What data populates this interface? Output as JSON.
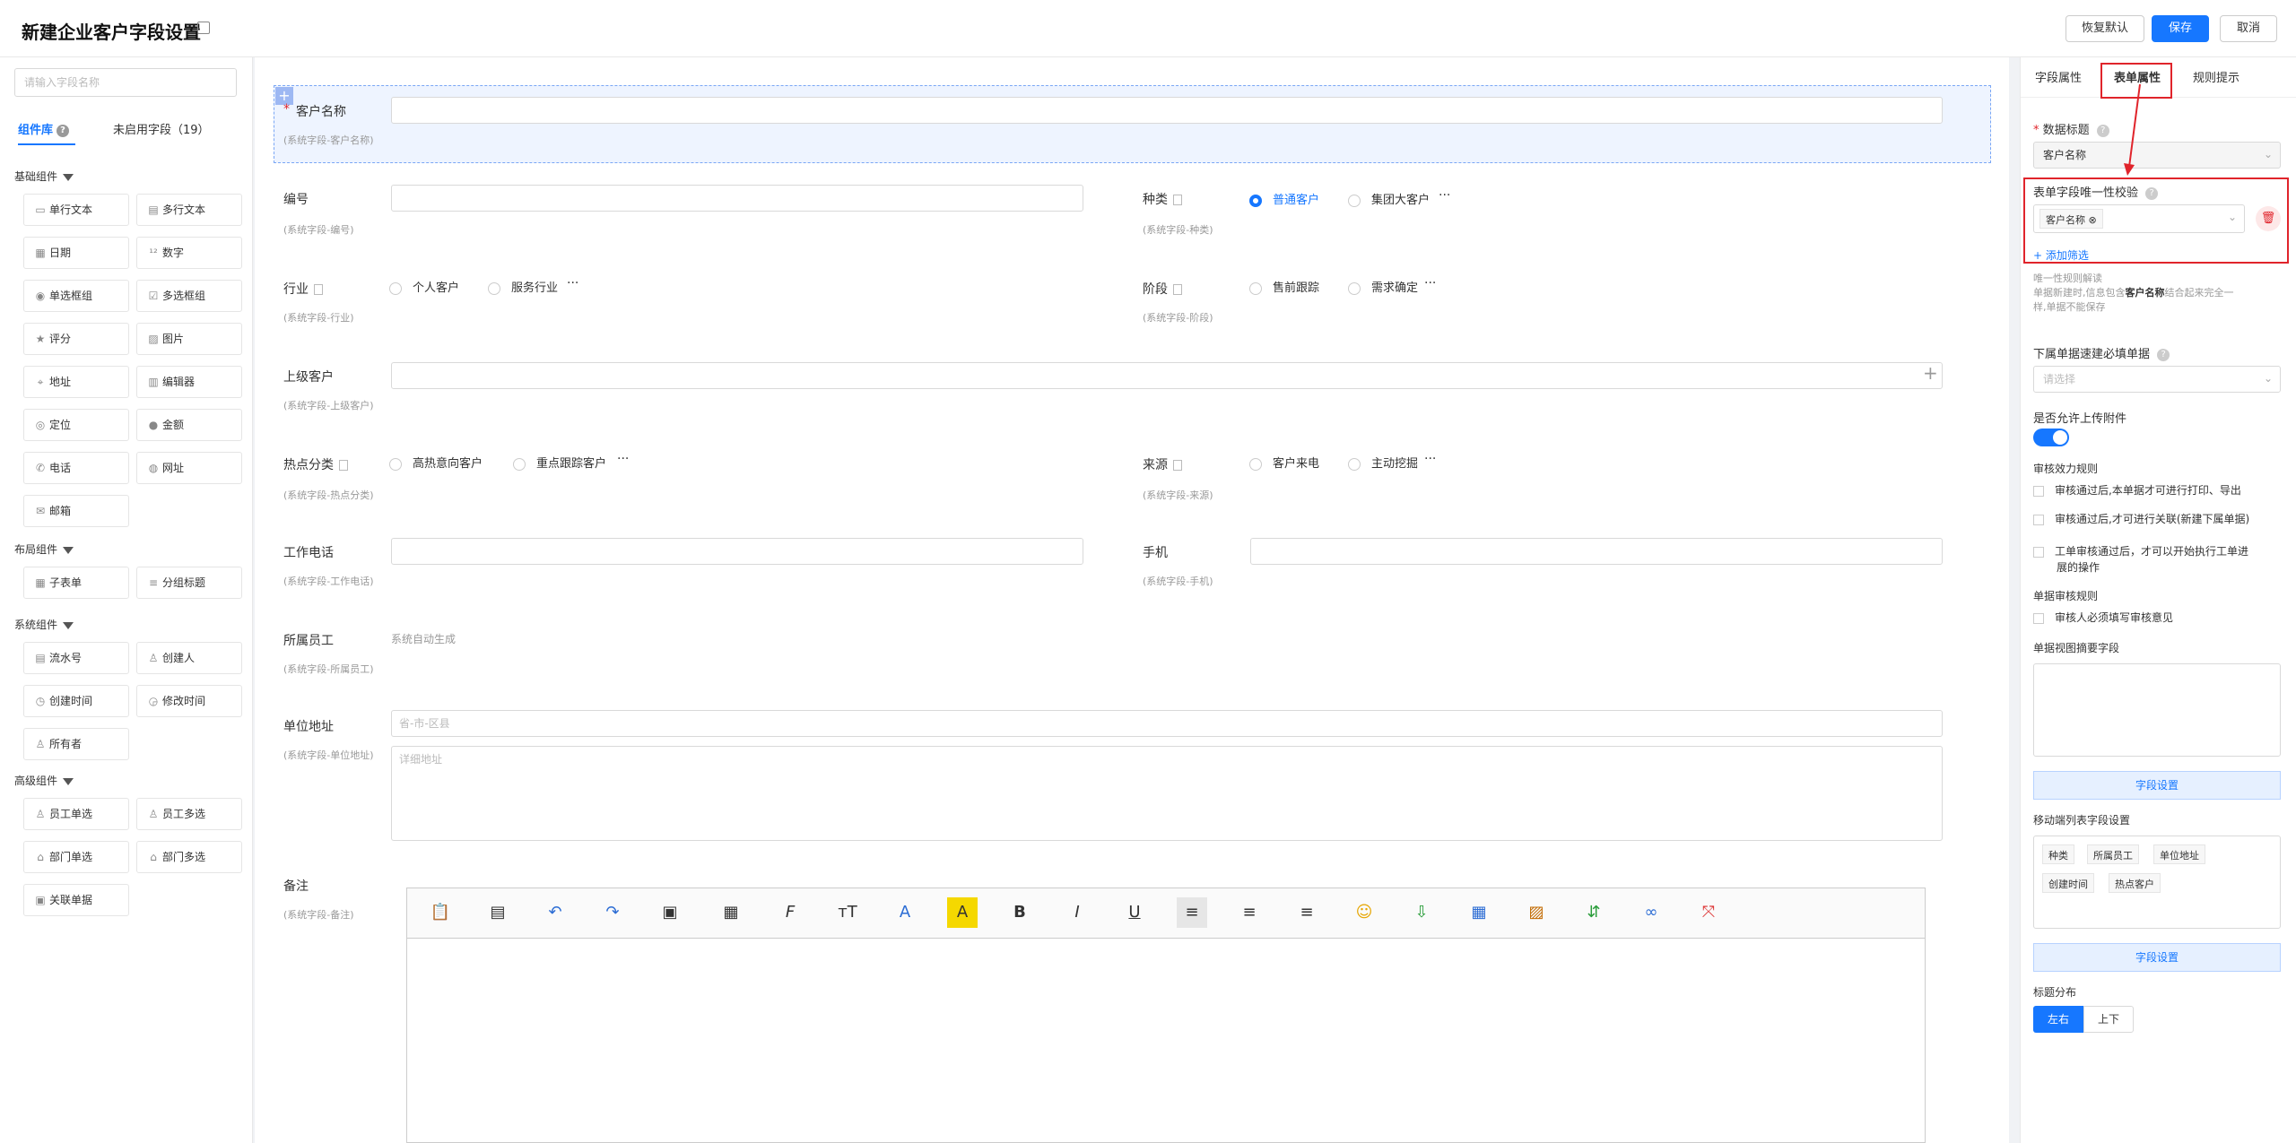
{
  "header": {
    "title": "新建企业客户字段设置",
    "restore": "恢复默认",
    "save": "保存",
    "cancel": "取消"
  },
  "left": {
    "search_placeholder": "请输入字段名称",
    "tab_library": "组件库",
    "tab_unused": "未启用字段（19）",
    "sections": [
      {
        "title": "基础组件",
        "items": [
          {
            "label": "单行文本",
            "icon": "▭"
          },
          {
            "label": "多行文本",
            "icon": "▤"
          },
          {
            "label": "日期",
            "icon": "▦"
          },
          {
            "label": "数字",
            "icon": "¹²"
          },
          {
            "label": "单选框组",
            "icon": "◉"
          },
          {
            "label": "多选框组",
            "icon": "☑"
          },
          {
            "label": "评分",
            "icon": "★"
          },
          {
            "label": "图片",
            "icon": "▨"
          },
          {
            "label": "地址",
            "icon": "⌖"
          },
          {
            "label": "编辑器",
            "icon": "▥"
          },
          {
            "label": "定位",
            "icon": "◎"
          },
          {
            "label": "金额",
            "icon": "●"
          },
          {
            "label": "电话",
            "icon": "✆"
          },
          {
            "label": "网址",
            "icon": "◍"
          },
          {
            "label": "邮箱",
            "icon": "✉"
          }
        ]
      },
      {
        "title": "布局组件",
        "items": [
          {
            "label": "子表单",
            "icon": "▦"
          },
          {
            "label": "分组标题",
            "icon": "≡"
          }
        ]
      },
      {
        "title": "系统组件",
        "items": [
          {
            "label": "流水号",
            "icon": "▤"
          },
          {
            "label": "创建人",
            "icon": "♙"
          },
          {
            "label": "创建时间",
            "icon": "◷"
          },
          {
            "label": "修改时间",
            "icon": "◶"
          },
          {
            "label": "所有者",
            "icon": "♙"
          }
        ]
      },
      {
        "title": "高级组件",
        "items": [
          {
            "label": "员工单选",
            "icon": "♙"
          },
          {
            "label": "员工多选",
            "icon": "♙"
          },
          {
            "label": "部门单选",
            "icon": "⌂"
          },
          {
            "label": "部门多选",
            "icon": "⌂"
          },
          {
            "label": "关联单据",
            "icon": "▣"
          }
        ]
      }
    ]
  },
  "form": {
    "customer_name": {
      "label": "客户名称",
      "sub": "(系统字段-客户名称)"
    },
    "number": {
      "label": "编号",
      "sub": "(系统字段-编号)"
    },
    "type": {
      "label": "种类",
      "sub": "(系统字段-种类)",
      "options": [
        "普通客户",
        "集团大客户"
      ]
    },
    "industry": {
      "label": "行业",
      "sub": "(系统字段-行业)",
      "options": [
        "个人客户",
        "服务行业"
      ]
    },
    "stage": {
      "label": "阶段",
      "sub": "(系统字段-阶段)",
      "options": [
        "售前跟踪",
        "需求确定"
      ]
    },
    "parent": {
      "label": "上级客户",
      "sub": "(系统字段-上级客户)"
    },
    "hot": {
      "label": "热点分类",
      "sub": "(系统字段-热点分类)",
      "options": [
        "高热意向客户",
        "重点跟踪客户"
      ]
    },
    "source": {
      "label": "来源",
      "sub": "(系统字段-来源)",
      "options": [
        "客户来电",
        "主动挖掘"
      ]
    },
    "work_phone": {
      "label": "工作电话",
      "sub": "(系统字段-工作电话)"
    },
    "mobile": {
      "label": "手机",
      "sub": "(系统字段-手机)"
    },
    "employee": {
      "label": "所属员工",
      "sub": "(系统字段-所属员工)",
      "value": "系统自动生成"
    },
    "address": {
      "label": "单位地址",
      "sub": "(系统字段-单位地址)",
      "ph1": "省-市-区县",
      "ph2": "详细地址"
    },
    "remark": {
      "label": "备注",
      "sub": "(系统字段-备注)"
    },
    "ellipsis": "···"
  },
  "right": {
    "tabs": [
      "字段属性",
      "表单属性",
      "规则提示"
    ],
    "data_title_label": "数据标题",
    "data_title_value": "客户名称",
    "unique_label": "表单字段唯一性校验",
    "unique_tag": "客户名称",
    "add_filter": "+ 添加筛选",
    "unique_note_title": "唯一性规则解读",
    "unique_note_a": "单据新建时,信息包含",
    "unique_note_b": "客户名称",
    "unique_note_c": "结合起来完全一",
    "unique_note_d": "样,单据不能保存",
    "required_label": "下属单据速建必填单据",
    "required_ph": "请选择",
    "attach_label": "是否允许上传附件",
    "audit_label": "审核效力规则",
    "audit_opts": [
      "审核通过后,本单据才可进行打印、导出",
      "审核通过后,才可进行关联(新建下属单据)",
      "工单审核通过后，才可以开始执行工单进",
      "展的操作"
    ],
    "review_label": "单据审核规则",
    "review_opt": "审核人必须填写审核意见",
    "summary_label": "单据视图摘要字段",
    "field_setting": "字段设置",
    "mobile_label": "移动端列表字段设置",
    "mobile_tags": [
      "种类",
      "所属员工",
      "单位地址",
      "创建时间",
      "热点客户"
    ],
    "title_dist_label": "标题分布",
    "dist_options": [
      "左右",
      "上下"
    ]
  },
  "colors": {
    "accent": "#1677ff",
    "annotation": "#e0242b"
  }
}
